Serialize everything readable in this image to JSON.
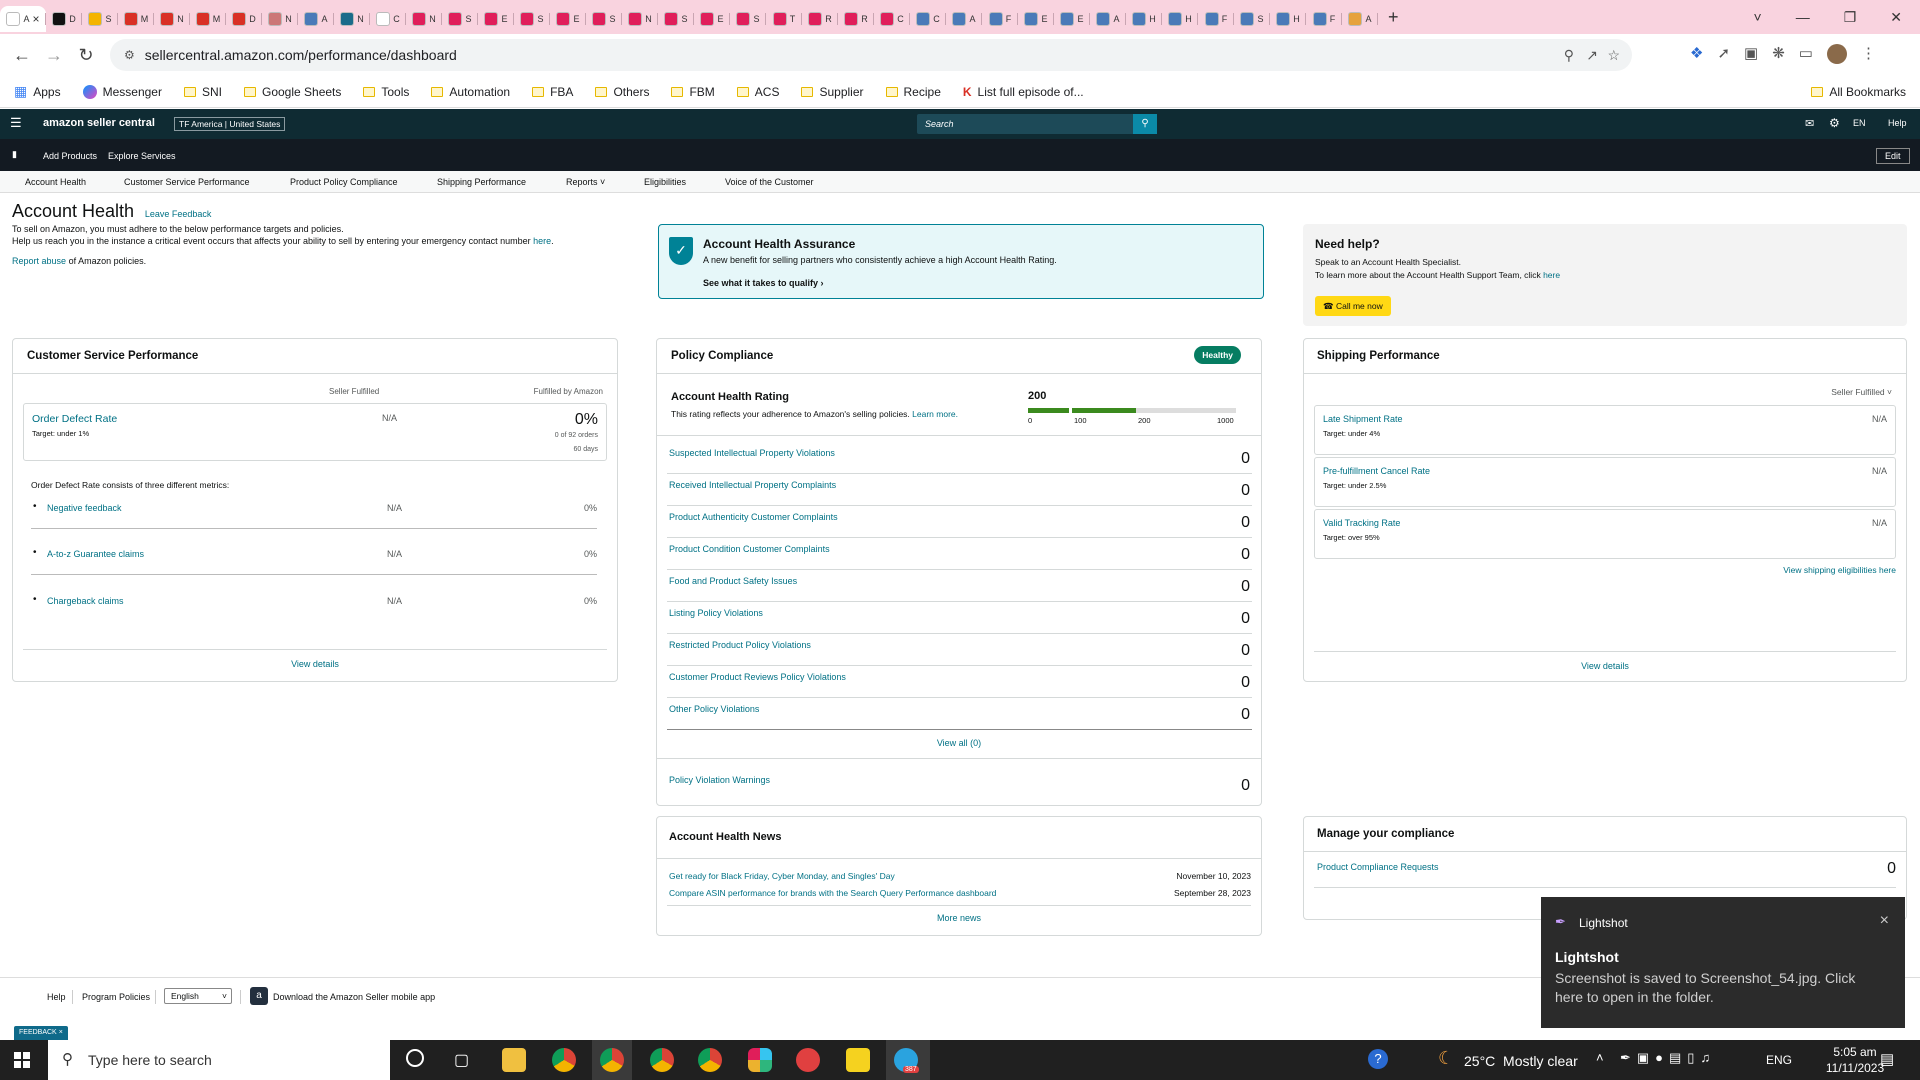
{
  "browser": {
    "tab_count_letters": [
      "A",
      "D",
      "S",
      "M",
      "N",
      "M",
      "D",
      "N",
      "A",
      "N",
      "C",
      "N",
      "S",
      "E",
      "S",
      "E",
      "S",
      "N",
      "S",
      "E",
      "S",
      "T",
      "R",
      "R",
      "C",
      "C",
      "A",
      "F",
      "E",
      "E",
      "A",
      "H",
      "H",
      "F",
      "S",
      "H",
      "F",
      "A"
    ],
    "url": "sellercentral.amazon.com/performance/dashboard",
    "bookmarks": [
      "Apps",
      "Messenger",
      "SNI",
      "Google Sheets",
      "Tools",
      "Automation",
      "FBA",
      "Others",
      "FBM",
      "ACS",
      "Supplier",
      "Recipe",
      "List full episode of...",
      "All Bookmarks"
    ]
  },
  "header": {
    "logo_text": "amazon seller central",
    "store": "TF America | United States",
    "search_placeholder": "Search",
    "lang": "EN",
    "help": "Help",
    "nav": [
      "Add Products",
      "Explore Services"
    ],
    "edit": "Edit"
  },
  "subnav": [
    "Account Health",
    "Customer Service Performance",
    "Product Policy Compliance",
    "Shipping Performance",
    "Reports",
    "Eligibilities",
    "Voice of the Customer"
  ],
  "intro": {
    "title": "Account Health",
    "feedback": "Leave Feedback",
    "line1": "To sell on Amazon, you must adhere to the below performance targets and policies.",
    "line2": "Help us reach you in the instance a critical event occurs that affects your ability to sell by entering your emergency contact number",
    "line2_link": "here",
    "report_link": "Report abuse",
    "report_rest": "of Amazon policies."
  },
  "assurance": {
    "title": "Account Health Assurance",
    "desc": "A new benefit for selling partners who consistently achieve a high Account Health Rating.",
    "link": "See what it takes to qualify"
  },
  "needhelp": {
    "title": "Need help?",
    "line1": "Speak to an Account Health Specialist.",
    "line2": "To learn more about the Account Health Support Team, click",
    "line2_link": "here",
    "button": "Call me now"
  },
  "csp": {
    "title": "Customer Service Performance",
    "col1": "Seller Fulfilled",
    "col2": "Fulfilled by Amazon",
    "odr_label": "Order Defect Rate",
    "odr_target": "Target: under 1%",
    "odr_sf": "N/A",
    "odr_fba": "0%",
    "odr_orders": "0 of 92 orders",
    "odr_days": "60 days",
    "metrics_intro": "Order Defect Rate consists of three different metrics:",
    "metrics": [
      {
        "label": "Negative feedback",
        "sf": "N/A",
        "fba": "0%"
      },
      {
        "label": "A-to-z Guarantee claims",
        "sf": "N/A",
        "fba": "0%"
      },
      {
        "label": "Chargeback claims",
        "sf": "N/A",
        "fba": "0%"
      }
    ],
    "view": "View details"
  },
  "policy": {
    "title": "Policy Compliance",
    "badge": "Healthy",
    "ahr_title": "Account Health Rating",
    "ahr_desc": "This rating reflects your adherence to Amazon's selling policies.",
    "ahr_learn": "Learn more.",
    "ahr_value": "200",
    "ahr_ticks": [
      "0",
      "100",
      "200",
      "1000"
    ],
    "rows": [
      {
        "label": "Suspected Intellectual Property Violations",
        "value": "0"
      },
      {
        "label": "Received Intellectual Property Complaints",
        "value": "0"
      },
      {
        "label": "Product Authenticity Customer Complaints",
        "value": "0"
      },
      {
        "label": "Product Condition Customer Complaints",
        "value": "0"
      },
      {
        "label": "Food and Product Safety Issues",
        "value": "0"
      },
      {
        "label": "Listing Policy Violations",
        "value": "0"
      },
      {
        "label": "Restricted Product Policy Violations",
        "value": "0"
      },
      {
        "label": "Customer Product Reviews Policy Violations",
        "value": "0"
      },
      {
        "label": "Other Policy Violations",
        "value": "0"
      }
    ],
    "view_all": "View all (0)",
    "warnings_label": "Policy Violation Warnings",
    "warnings_value": "0"
  },
  "shipping": {
    "title": "Shipping Performance",
    "filter": "Seller Fulfilled",
    "rows": [
      {
        "label": "Late Shipment Rate",
        "target": "Target: under 4%",
        "value": "N/A"
      },
      {
        "label": "Pre-fulfillment Cancel Rate",
        "target": "Target: under 2.5%",
        "value": "N/A"
      },
      {
        "label": "Valid Tracking Rate",
        "target": "Target: over 95%",
        "value": "N/A"
      }
    ],
    "elig": "View shipping eligibilities here",
    "view": "View details"
  },
  "news": {
    "title": "Account Health News",
    "items": [
      {
        "label": "Get ready for Black Friday, Cyber Monday, and Singles' Day",
        "date": "November 10, 2023"
      },
      {
        "label": "Compare ASIN performance for brands with the Search Query Performance dashboard",
        "date": "September 28, 2023"
      }
    ],
    "more": "More news"
  },
  "manage": {
    "title": "Manage your compliance",
    "row_label": "Product Compliance Requests",
    "row_value": "0"
  },
  "footer": {
    "help": "Help",
    "policies": "Program Policies",
    "lang": "English",
    "app": "Download the Amazon Seller mobile app",
    "feedback": "FEEDBACK"
  },
  "toast": {
    "app": "Lightshot",
    "title": "Lightshot",
    "body": "Screenshot is saved to Screenshot_54.jpg. Click here to open in the folder."
  },
  "taskbar": {
    "search": "Type here to search",
    "weather": "25°C  Mostly clear",
    "lang": "ENG",
    "time": "5:05 am",
    "date": "11/11/2023",
    "telegram_badge": "387"
  }
}
